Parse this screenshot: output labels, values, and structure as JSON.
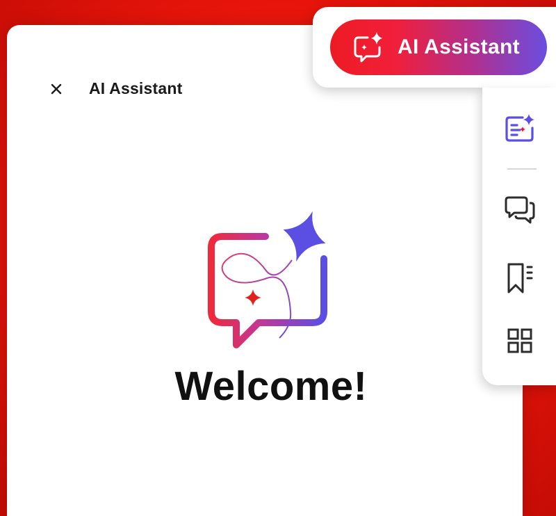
{
  "panel": {
    "title": "AI Assistant",
    "close_icon": "close-icon",
    "welcome_text": "Welcome!"
  },
  "ai_button": {
    "label": "AI Assistant",
    "icon": "ai-chat-sparkle-icon"
  },
  "toolbar": {
    "items": [
      {
        "icon": "ai-summary-icon"
      },
      {
        "icon": "comments-icon"
      },
      {
        "icon": "bookmarks-icon"
      },
      {
        "icon": "thumbnails-grid-icon"
      }
    ]
  },
  "colors": {
    "gradient_start": "#ee1b24",
    "gradient_end": "#6a4ee0",
    "accent_purple": "#5c4ee5",
    "accent_red": "#ee1b24"
  }
}
